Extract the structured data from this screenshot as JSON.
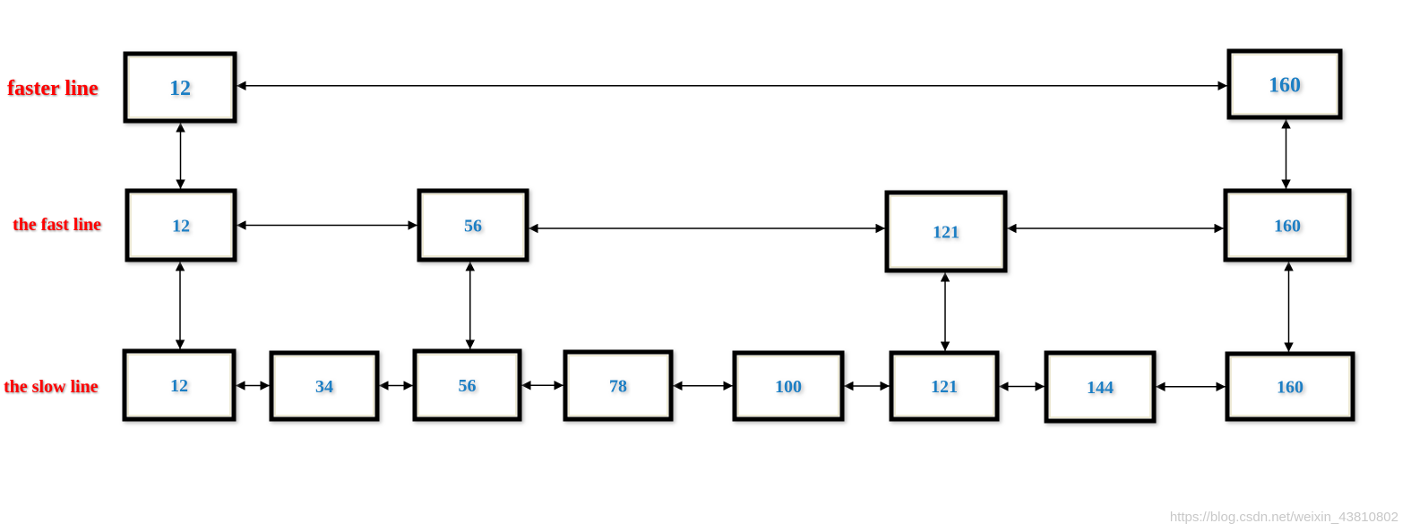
{
  "rows": [
    {
      "label": "faster line",
      "nodes": [
        "12",
        "160"
      ]
    },
    {
      "label": "the fast line",
      "nodes": [
        "12",
        "56",
        "121",
        "160"
      ]
    },
    {
      "label": "the slow line",
      "nodes": [
        "12",
        "34",
        "56",
        "78",
        "100",
        "121",
        "144",
        "160"
      ]
    }
  ],
  "vertical_links": [
    {
      "value": "12",
      "from_row": 0,
      "to_row": 1
    },
    {
      "value": "160",
      "from_row": 0,
      "to_row": 1
    },
    {
      "value": "12",
      "from_row": 1,
      "to_row": 2
    },
    {
      "value": "56",
      "from_row": 1,
      "to_row": 2
    },
    {
      "value": "121",
      "from_row": 1,
      "to_row": 2
    },
    {
      "value": "160",
      "from_row": 1,
      "to_row": 2
    }
  ],
  "colors": {
    "label": "#ff0000",
    "node_text": "#1a7fc4",
    "box_border": "#000000",
    "arrow": "#000000"
  },
  "watermark": "https://blog.csdn.net/weixin_43810802"
}
